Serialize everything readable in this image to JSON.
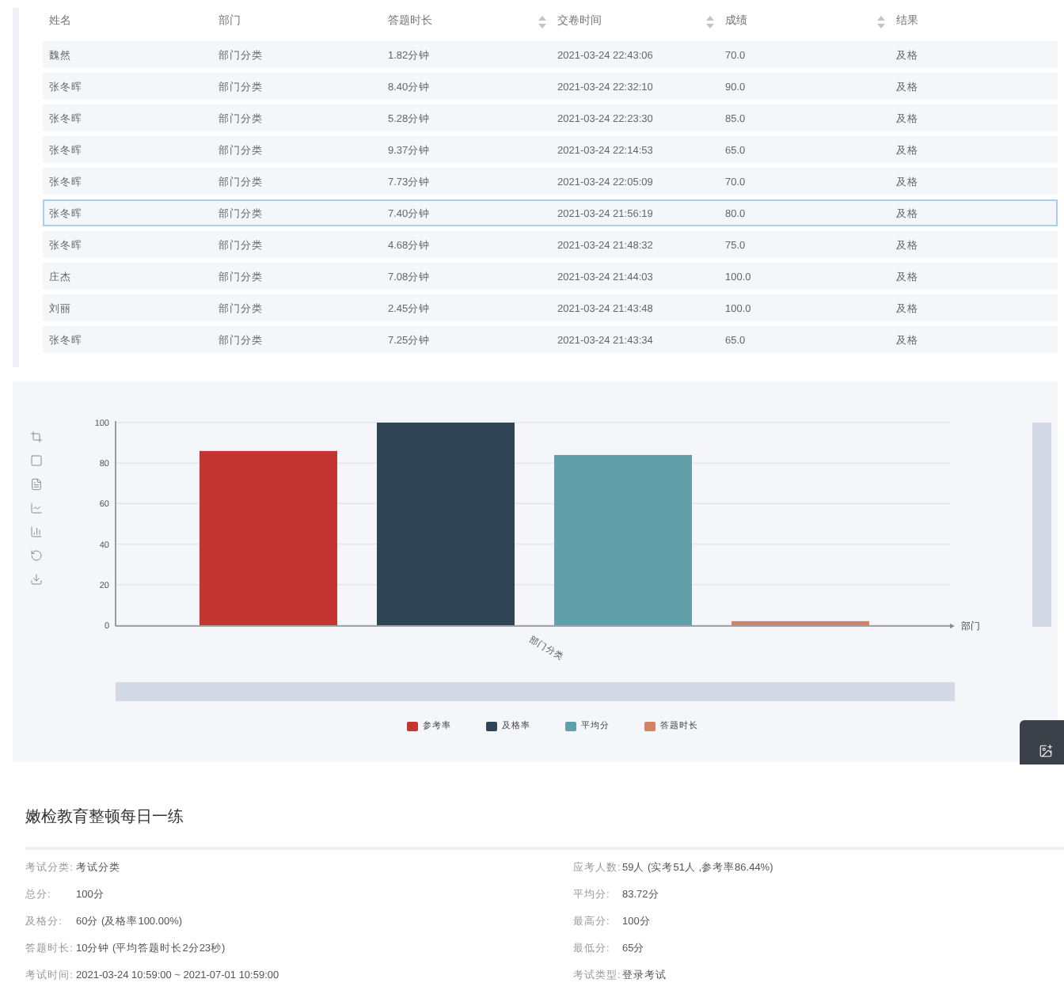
{
  "table": {
    "columns": [
      {
        "label": "姓名",
        "sortable": false
      },
      {
        "label": "部门",
        "sortable": false
      },
      {
        "label": "答题时长",
        "sortable": false
      },
      {
        "label": "交卷时间",
        "sortable": true
      },
      {
        "label": "成绩",
        "sortable": true
      },
      {
        "label": "结果",
        "sortable": true
      }
    ],
    "rows": [
      {
        "cells": [
          "魏然",
          "部门分类",
          "1.82分钟",
          "2021-03-24 22:43:06",
          "70.0",
          "及格"
        ],
        "selected": false
      },
      {
        "cells": [
          "张冬晖",
          "部门分类",
          "8.40分钟",
          "2021-03-24 22:32:10",
          "90.0",
          "及格"
        ],
        "selected": false
      },
      {
        "cells": [
          "张冬晖",
          "部门分类",
          "5.28分钟",
          "2021-03-24 22:23:30",
          "85.0",
          "及格"
        ],
        "selected": false
      },
      {
        "cells": [
          "张冬晖",
          "部门分类",
          "9.37分钟",
          "2021-03-24 22:14:53",
          "65.0",
          "及格"
        ],
        "selected": false
      },
      {
        "cells": [
          "张冬晖",
          "部门分类",
          "7.73分钟",
          "2021-03-24 22:05:09",
          "70.0",
          "及格"
        ],
        "selected": false
      },
      {
        "cells": [
          "张冬晖",
          "部门分类",
          "7.40分钟",
          "2021-03-24 21:56:19",
          "80.0",
          "及格"
        ],
        "selected": true
      },
      {
        "cells": [
          "张冬晖",
          "部门分类",
          "4.68分钟",
          "2021-03-24 21:48:32",
          "75.0",
          "及格"
        ],
        "selected": false
      },
      {
        "cells": [
          "庄杰",
          "部门分类",
          "7.08分钟",
          "2021-03-24 21:44:03",
          "100.0",
          "及格"
        ],
        "selected": false
      },
      {
        "cells": [
          "刘丽",
          "部门分类",
          "2.45分钟",
          "2021-03-24 21:43:48",
          "100.0",
          "及格"
        ],
        "selected": false
      },
      {
        "cells": [
          "张冬晖",
          "部门分类",
          "7.25分钟",
          "2021-03-24 21:43:34",
          "65.0",
          "及格"
        ],
        "selected": false
      }
    ]
  },
  "chart": {
    "chart_data": {
      "type": "bar",
      "xlabel": "部门",
      "categories": [
        "部门分类"
      ],
      "series": [
        {
          "name": "参考率",
          "color": "#c23531",
          "values": [
            86
          ]
        },
        {
          "name": "及格率",
          "color": "#2f4554",
          "values": [
            100
          ]
        },
        {
          "name": "平均分",
          "color": "#61a0a8",
          "values": [
            84
          ]
        },
        {
          "name": "答题时长",
          "color": "#d48265",
          "values": [
            2
          ]
        }
      ],
      "ylim": [
        0,
        100
      ],
      "yticks": [
        0,
        20,
        40,
        60,
        80,
        100
      ],
      "grid": true
    }
  },
  "exam": {
    "title": "嫩检教育整顿每日一练",
    "left": [
      {
        "label": "考试分类:",
        "value": "考试分类"
      },
      {
        "label": "总分:",
        "value": "100分"
      },
      {
        "label": "及格分:",
        "value": "60分 (及格率100.00%)"
      },
      {
        "label": "答题时长:",
        "value": "10分钟 (平均答题时长2分23秒)"
      },
      {
        "label": "考试时间:",
        "value": "2021-03-24 10:59:00 ~ 2021-07-01 10:59:00"
      }
    ],
    "right": [
      {
        "label": "应考人数:",
        "value": "59人 (实考51人 ,参考率86.44%)"
      },
      {
        "label": "平均分:",
        "value": "83.72分"
      },
      {
        "label": "最高分:",
        "value": "100分"
      },
      {
        "label": "最低分:",
        "value": "65分"
      },
      {
        "label": "考试类型:",
        "value": "登录考试"
      }
    ]
  }
}
